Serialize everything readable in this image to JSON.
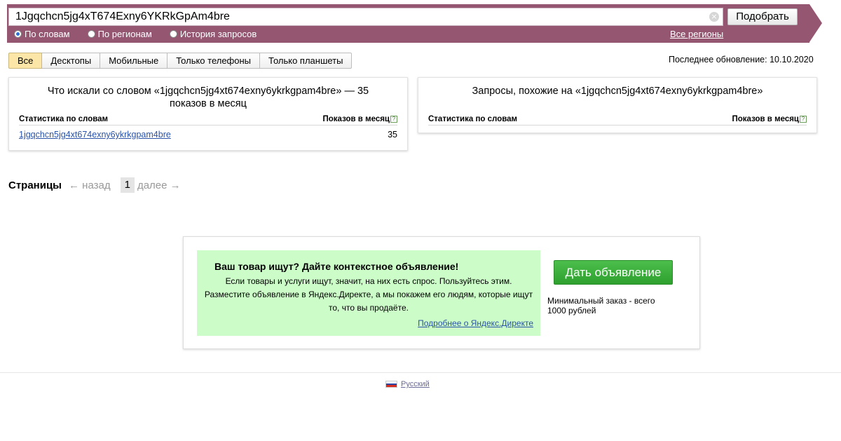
{
  "search": {
    "value": "1Jgqchcn5jg4xT674Exny6YKRkGpAm4bre",
    "button_label": "Подобрать",
    "modes": [
      {
        "label": "По словам",
        "checked": true
      },
      {
        "label": "По регионам",
        "checked": false
      },
      {
        "label": "История запросов",
        "checked": false
      }
    ],
    "regions_link": "Все регионы"
  },
  "tabs": [
    "Все",
    "Десктопы",
    "Мобильные",
    "Только телефоны",
    "Только планшеты"
  ],
  "active_tab": "Все",
  "last_update": "Последнее обновление: 10.10.2020",
  "left_panel": {
    "title": "Что искали со словом «1jgqchcn5jg4xt674exny6ykrkgpam4bre» — 35 показов в месяц",
    "col_stat": "Статистика по словам",
    "col_shows": "Показов в месяц",
    "rows": [
      {
        "phrase": "1jgqchcn5jg4xt674exny6ykrkgpam4bre",
        "count": "35"
      }
    ]
  },
  "right_panel": {
    "title": "Запросы, похожие на «1jgqchcn5jg4xt674exny6ykrkgpam4bre»",
    "col_stat": "Статистика по словам",
    "col_shows": "Показов в месяц"
  },
  "pager": {
    "title": "Страницы",
    "prev": "← назад",
    "current": "1",
    "next": "далее →"
  },
  "ad": {
    "title": "Ваш товар ищут? Дайте контекстное объявление!",
    "text": "Если товары и услуги ищут, значит, на них есть спрос. Пользуйтесь этим. Разместите объявление в Яндекс.Директе, а мы покажем его людям, которые ищут то, что вы продаёте.",
    "more_link": "Подробнее о Яндекс.Директе",
    "button_label": "Дать объявление",
    "min_order": "Минимальный заказ - всего 1000 рублей"
  },
  "footer": {
    "language": "Русский"
  },
  "colors": {
    "header": "#955672",
    "active_tab": "#fbe6a8",
    "ad_background": "#ccfcc8",
    "ad_button": "#3cb03c",
    "link": "#2a52a8"
  }
}
